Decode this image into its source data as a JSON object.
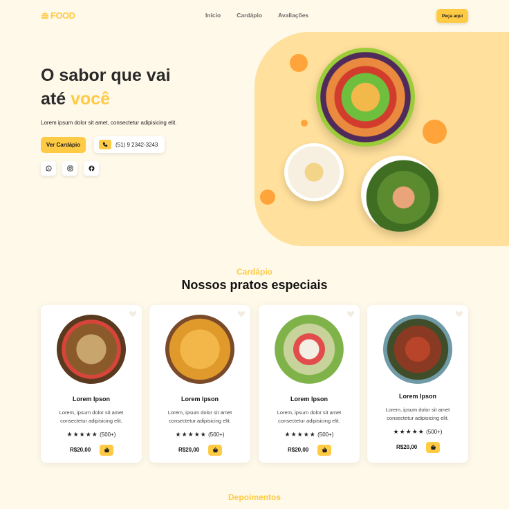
{
  "header": {
    "logo_text": "FOOD",
    "nav": [
      "Início",
      "Cardápio",
      "Avaliações"
    ],
    "order_button": "Peça aqui"
  },
  "hero": {
    "title_line1": "O sabor que vai",
    "title_line2_prefix": "até ",
    "title_line2_accent": "você",
    "description": "Lorem ipsum dolor sit amet, consectetur adipisicing elit.",
    "menu_button": "Ver Cardápio",
    "phone": "(51) 9 2342-3243",
    "socials": [
      "whatsapp-icon",
      "instagram-icon",
      "facebook-icon"
    ]
  },
  "menu_section": {
    "subtitle": "Cardápio",
    "title": "Nossos pratos especiais",
    "cards": [
      {
        "name": "Lorem Ipson",
        "desc": "Lorem, ipsum dolor sit amet consectetur adipisicing elit.",
        "stars": "★★★★★",
        "count": "(500+)",
        "price": "R$20,00"
      },
      {
        "name": "Lorem Ipson",
        "desc": "Lorem, ipsum dolor sit amet consectetur adipisicing elit.",
        "stars": "★★★★★",
        "count": "(500+)",
        "price": "R$20,00"
      },
      {
        "name": "Lorem Ipson",
        "desc": "Lorem, ipsum dolor sit amet consectetur adipisicing elit.",
        "stars": "★★★★★",
        "count": "(500+)",
        "price": "R$20,00"
      },
      {
        "name": "Lorem Ipson",
        "desc": "Lorem, ipsum dolor sit amet consectetur adipisicing elit.",
        "stars": "★★★★★",
        "count": "(500+)",
        "price": "R$20,00"
      }
    ]
  },
  "testimonials_section": {
    "subtitle": "Depoimentos"
  },
  "colors": {
    "accent": "#ffcb45",
    "background": "#fff9ea",
    "hero_blob": "#ffe09c",
    "dot": "#ffa43a"
  }
}
